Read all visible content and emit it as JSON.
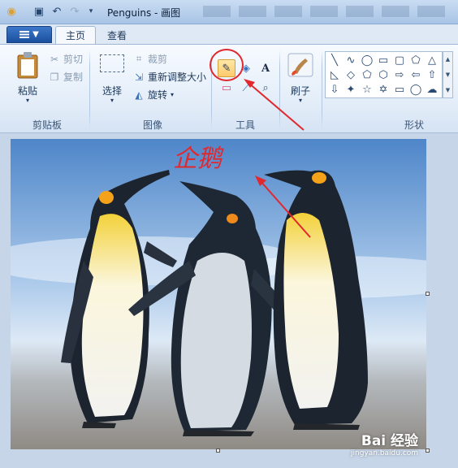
{
  "window": {
    "title": "Penguins - 画图"
  },
  "tabs": {
    "app_menu": "▼",
    "home": "主页",
    "view": "查看"
  },
  "clipboard": {
    "paste": "粘贴",
    "cut": "剪切",
    "copy": "复制",
    "group_label": "剪贴板"
  },
  "image": {
    "select": "选择",
    "crop": "裁剪",
    "resize": "重新调整大小",
    "rotate": "旋转",
    "group_label": "图像"
  },
  "tools": {
    "text_tool": "A",
    "group_label": "工具"
  },
  "brushes": {
    "label": "刷子"
  },
  "shapes": {
    "group_label": "形状"
  },
  "canvas": {
    "annotation": "企鹅"
  },
  "watermark": {
    "main": "Bai 经验",
    "sub": "jingyan.baidu.com"
  },
  "colors": {
    "highlight": "#e0282e",
    "accent": "#1b4f9f"
  }
}
